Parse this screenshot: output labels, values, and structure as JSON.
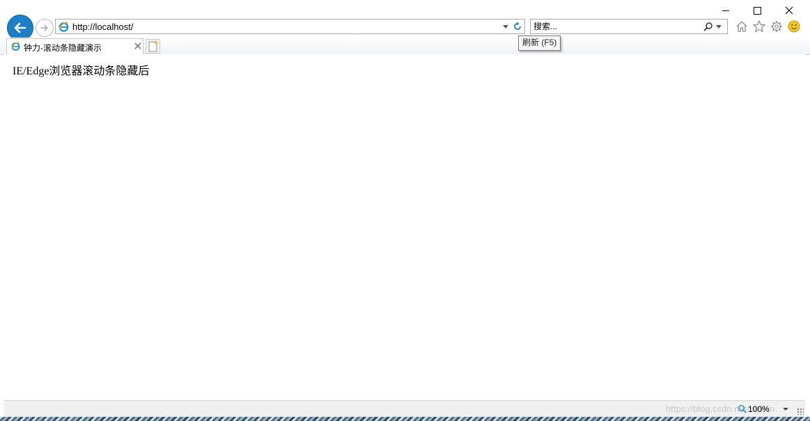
{
  "browser": {
    "address_url": "http://localhost/",
    "search_placeholder": "搜索...",
    "refresh_tooltip": "刷新 (F5)",
    "tab_title": "钟力-滚动条隐藏演示",
    "zoom_level": "100%",
    "watermark": "https://blog.csdn.net/weixin"
  },
  "page": {
    "body_text": "IE/Edge浏览器滚动条隐藏后"
  },
  "icons": {
    "back": "back-arrow-icon",
    "forward": "forward-arrow-icon",
    "site": "ie-logo-icon",
    "refresh": "refresh-icon",
    "search": "magnifier-icon",
    "home": "home-icon",
    "favorites": "star-icon",
    "tools": "gear-icon",
    "feedback": "smiley-icon",
    "new_tab": "new-tab-icon",
    "close_tab": "close-icon"
  },
  "colors": {
    "accent": "#1e7fc6",
    "feedback": "#f3c623",
    "tooltip_bg": "#f7f7f7"
  }
}
